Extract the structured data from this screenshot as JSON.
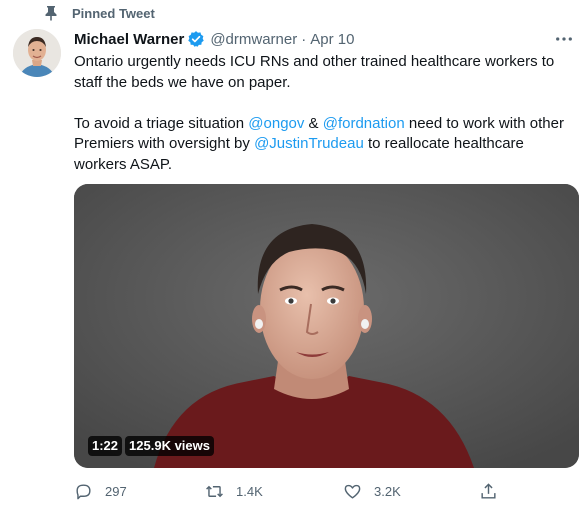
{
  "pinned": {
    "label": "Pinned Tweet",
    "icon": "pin-icon"
  },
  "tweet": {
    "author_name": "Michael Warner",
    "verified": true,
    "handle": "@drmwarner",
    "separator": "·",
    "date": "Apr 10",
    "paragraph1": "Ontario urgently needs ICU RNs and other trained healthcare workers to staff the beds we have on paper.",
    "paragraph2": {
      "part1": "To avoid a triage situation ",
      "mention1": "@ongov",
      "part2": " & ",
      "mention2": "@fordnation",
      "part3": " need to work with other Premiers with oversight by ",
      "mention3": "@JustinTrudeau",
      "part4": " to reallocate healthcare workers ASAP."
    },
    "video": {
      "duration": "1:22",
      "views": "125.9K views"
    },
    "actions": {
      "replies": "297",
      "retweets": "1.4K",
      "likes": "3.2K"
    }
  },
  "colors": {
    "accent": "#1d9bf0",
    "secondary_text": "#536471",
    "primary_text": "#0f1419"
  }
}
